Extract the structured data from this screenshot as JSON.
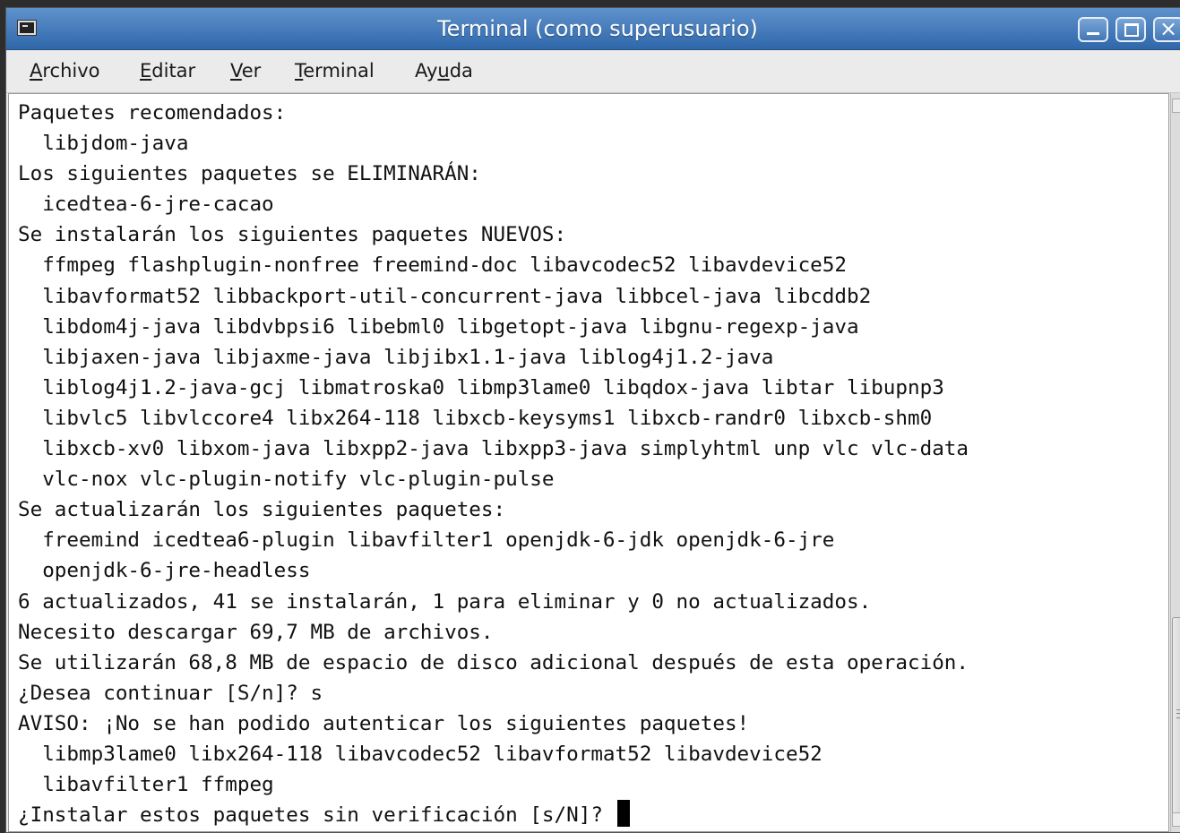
{
  "window": {
    "title": "Terminal (como superusuario)"
  },
  "menubar": {
    "items": [
      {
        "label": "Archivo",
        "mnemonic_char": "A"
      },
      {
        "label": "Editar",
        "mnemonic_char": "E"
      },
      {
        "label": "Ver",
        "mnemonic_char": "V"
      },
      {
        "label": "Terminal",
        "mnemonic_char": "T"
      },
      {
        "label": "Ayuda",
        "mnemonic_char": "u"
      }
    ]
  },
  "terminal": {
    "lines": [
      "Paquetes recomendados:",
      "  libjdom-java",
      "Los siguientes paquetes se ELIMINARÁN:",
      "  icedtea-6-jre-cacao",
      "Se instalarán los siguientes paquetes NUEVOS:",
      "  ffmpeg flashplugin-nonfree freemind-doc libavcodec52 libavdevice52",
      "  libavformat52 libbackport-util-concurrent-java libbcel-java libcddb2",
      "  libdom4j-java libdvbpsi6 libebml0 libgetopt-java libgnu-regexp-java",
      "  libjaxen-java libjaxme-java libjibx1.1-java liblog4j1.2-java",
      "  liblog4j1.2-java-gcj libmatroska0 libmp3lame0 libqdox-java libtar libupnp3",
      "  libvlc5 libvlccore4 libx264-118 libxcb-keysyms1 libxcb-randr0 libxcb-shm0",
      "  libxcb-xv0 libxom-java libxpp2-java libxpp3-java simplyhtml unp vlc vlc-data",
      "  vlc-nox vlc-plugin-notify vlc-plugin-pulse",
      "Se actualizarán los siguientes paquetes:",
      "  freemind icedtea6-plugin libavfilter1 openjdk-6-jdk openjdk-6-jre",
      "  openjdk-6-jre-headless",
      "6 actualizados, 41 se instalarán, 1 para eliminar y 0 no actualizados.",
      "Necesito descargar 69,7 MB de archivos.",
      "Se utilizarán 68,8 MB de espacio de disco adicional después de esta operación.",
      "¿Desea continuar [S/n]? s",
      "AVISO: ¡No se han podido autenticar los siguientes paquetes!",
      "  libmp3lame0 libx264-118 libavcodec52 libavformat52 libavdevice52",
      "  libavfilter1 ffmpeg"
    ],
    "prompt": "¿Instalar estos paquetes sin verificación [s/N]? "
  },
  "colors": {
    "titlebar": "#3f74b5",
    "terminal_bg": "#ffffff",
    "terminal_fg": "#111111"
  }
}
